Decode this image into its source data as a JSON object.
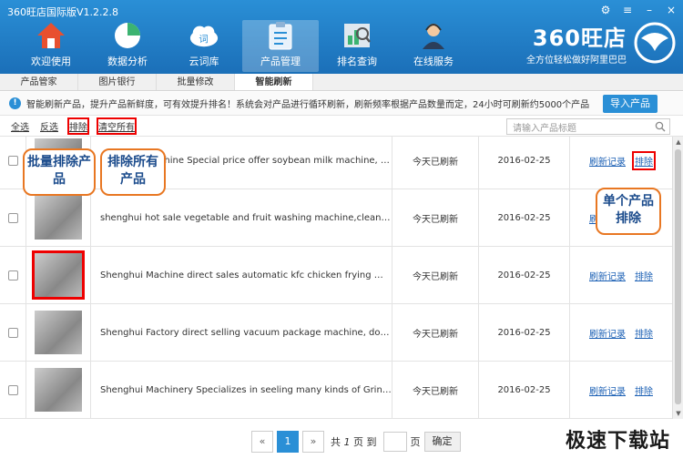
{
  "window": {
    "title": "360旺店国际版V1.2.2.8"
  },
  "nav": [
    {
      "label": "欢迎使用",
      "icon": "home-icon"
    },
    {
      "label": "数据分析",
      "icon": "pie-chart-icon"
    },
    {
      "label": "云词库",
      "icon": "cloud-words-icon"
    },
    {
      "label": "产品管理",
      "icon": "clipboard-icon",
      "active": true
    },
    {
      "label": "排名查询",
      "icon": "ranking-icon"
    },
    {
      "label": "在线服务",
      "icon": "support-agent-icon"
    }
  ],
  "logo": {
    "main": "360旺店",
    "sub": "全方位轻松做好阿里巴巴"
  },
  "subtabs": [
    "产品管家",
    "图片银行",
    "批量修改",
    "智能刷新"
  ],
  "notice": {
    "text": "智能刷新产品，提升产品新鲜度，可有效提升排名！系统会对产品进行循环刷新，刷新频率根据产品数量而定，24小时可刷新约5000个产品",
    "import_label": "导入产品"
  },
  "toolbar": {
    "select_all": "全选",
    "invert": "反选",
    "exclude": "排除",
    "clear_all": "清空所有",
    "search_placeholder": "请输入产品标题"
  },
  "rows": [
    {
      "title": "Shenghui Machine Special price offer soybean milk machine, multifu...",
      "status": "今天已刷新",
      "date": "2016-02-25",
      "log": "刷新记录",
      "exclude": "排除"
    },
    {
      "title": "shenghui hot sale vegetable and fruit washing machine,cleaning ma...",
      "status": "今天已刷新",
      "date": "2016-02-25",
      "log": "刷新记录",
      "exclude": "排除"
    },
    {
      "title": "Shenghui Machine direct sales automatic kfc chicken frying machine...",
      "status": "今天已刷新",
      "date": "2016-02-25",
      "log": "刷新记录",
      "exclude": "排除"
    },
    {
      "title": "Shenghui Factory direct selling vacuum package machine, double ch...",
      "status": "今天已刷新",
      "date": "2016-02-25",
      "log": "刷新记录",
      "exclude": "排除"
    },
    {
      "title": "Shenghui Machinery Specializes in seeling many kinds of Grinder /S...",
      "status": "今天已刷新",
      "date": "2016-02-25",
      "log": "刷新记录",
      "exclude": "排除"
    }
  ],
  "callouts": {
    "batch": "批量排除产品",
    "clear": "排除所有产品",
    "single": "单个产品排除"
  },
  "pager": {
    "prev": "«",
    "current": "1",
    "next": "»",
    "total_prefix": "共",
    "total": "1",
    "total_suffix": "页 到",
    "page_suffix": "页",
    "ok": "确定"
  },
  "watermark": "极速下载站"
}
